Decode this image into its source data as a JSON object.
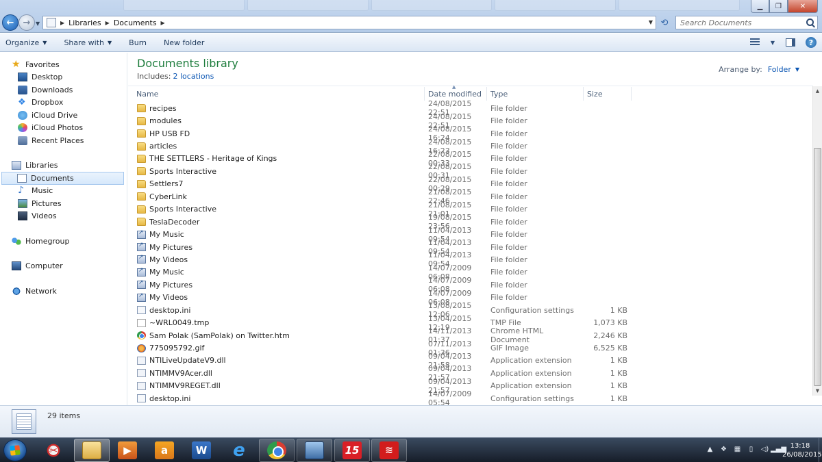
{
  "window": {
    "controls": [
      "minimize",
      "maximize",
      "close"
    ]
  },
  "address": {
    "crumbs": [
      "Libraries",
      "Documents"
    ]
  },
  "search": {
    "placeholder": "Search Documents"
  },
  "toolbar": {
    "organize": "Organize",
    "share_with": "Share with",
    "burn": "Burn",
    "new_folder": "New folder"
  },
  "navpane": {
    "favorites": {
      "label": "Favorites",
      "items": [
        {
          "label": "Desktop",
          "icon": "desktop-icon"
        },
        {
          "label": "Downloads",
          "icon": "downloads-icon"
        },
        {
          "label": "Dropbox",
          "icon": "dropbox-icon"
        },
        {
          "label": "iCloud Drive",
          "icon": "icloud-icon"
        },
        {
          "label": "iCloud Photos",
          "icon": "icloud-photos-icon"
        },
        {
          "label": "Recent Places",
          "icon": "recent-places-icon"
        }
      ]
    },
    "libraries": {
      "label": "Libraries",
      "items": [
        {
          "label": "Documents",
          "icon": "documents-icon",
          "selected": true
        },
        {
          "label": "Music",
          "icon": "music-icon"
        },
        {
          "label": "Pictures",
          "icon": "pictures-icon"
        },
        {
          "label": "Videos",
          "icon": "videos-icon"
        }
      ]
    },
    "homegroup": "Homegroup",
    "computer": "Computer",
    "network": "Network"
  },
  "library": {
    "title": "Documents library",
    "includes_label": "Includes:",
    "includes_link": "2 locations",
    "arrange_label": "Arrange by:",
    "arrange_value": "Folder"
  },
  "columns": {
    "name": "Name",
    "date": "Date modified",
    "type": "Type",
    "size": "Size"
  },
  "files": [
    {
      "name": "recipes",
      "date": "24/08/2015 22:51",
      "type": "File folder",
      "size": "",
      "icon": "folder"
    },
    {
      "name": "modules",
      "date": "24/08/2015 22:51",
      "type": "File folder",
      "size": "",
      "icon": "folder"
    },
    {
      "name": "HP USB FD",
      "date": "24/08/2015 16:24",
      "type": "File folder",
      "size": "",
      "icon": "folder"
    },
    {
      "name": "articles",
      "date": "24/08/2015 16:23",
      "type": "File folder",
      "size": "",
      "icon": "folder"
    },
    {
      "name": "THE SETTLERS - Heritage of Kings",
      "date": "22/08/2015 00:33",
      "type": "File folder",
      "size": "",
      "icon": "folder"
    },
    {
      "name": "Sports Interactive",
      "date": "22/08/2015 00:31",
      "type": "File folder",
      "size": "",
      "icon": "folder"
    },
    {
      "name": "Settlers7",
      "date": "22/08/2015 00:29",
      "type": "File folder",
      "size": "",
      "icon": "folder"
    },
    {
      "name": "CyberLink",
      "date": "21/08/2015 22:46",
      "type": "File folder",
      "size": "",
      "icon": "folder"
    },
    {
      "name": "Sports Interactive",
      "date": "21/08/2015 21:01",
      "type": "File folder",
      "size": "",
      "icon": "folder"
    },
    {
      "name": "TeslaDecoder",
      "date": "19/08/2015 23:56",
      "type": "File folder",
      "size": "",
      "icon": "folder"
    },
    {
      "name": "My Music",
      "date": "11/04/2013 09:54",
      "type": "File folder",
      "size": "",
      "icon": "shortcut"
    },
    {
      "name": "My Pictures",
      "date": "11/04/2013 09:54",
      "type": "File folder",
      "size": "",
      "icon": "shortcut"
    },
    {
      "name": "My Videos",
      "date": "11/04/2013 09:54",
      "type": "File folder",
      "size": "",
      "icon": "shortcut"
    },
    {
      "name": "My Music",
      "date": "14/07/2009 06:08",
      "type": "File folder",
      "size": "",
      "icon": "shortcut"
    },
    {
      "name": "My Pictures",
      "date": "14/07/2009 06:08",
      "type": "File folder",
      "size": "",
      "icon": "shortcut"
    },
    {
      "name": "My Videos",
      "date": "14/07/2009 06:08",
      "type": "File folder",
      "size": "",
      "icon": "shortcut"
    },
    {
      "name": "desktop.ini",
      "date": "13/08/2015 12:06",
      "type": "Configuration settings",
      "size": "1 KB",
      "icon": "ini"
    },
    {
      "name": "~WRL0049.tmp",
      "date": "13/04/2015 12:19",
      "type": "TMP File",
      "size": "1,073 KB",
      "icon": "tmp"
    },
    {
      "name": "Sam Polak (SamPolak) on Twitter.htm",
      "date": "14/11/2013 01:37",
      "type": "Chrome HTML Document",
      "size": "2,246 KB",
      "icon": "chrome"
    },
    {
      "name": "775095792.gif",
      "date": "07/11/2013 01:36",
      "type": "GIF Image",
      "size": "6,525 KB",
      "icon": "gif"
    },
    {
      "name": "NTILiveUpdateV9.dll",
      "date": "09/04/2013 21:58",
      "type": "Application extension",
      "size": "1 KB",
      "icon": "dll"
    },
    {
      "name": "NTIMMV9Acer.dll",
      "date": "09/04/2013 21:57",
      "type": "Application extension",
      "size": "1 KB",
      "icon": "dll"
    },
    {
      "name": "NTIMMV9REGET.dll",
      "date": "09/04/2013 21:57",
      "type": "Application extension",
      "size": "1 KB",
      "icon": "dll"
    },
    {
      "name": "desktop.ini",
      "date": "14/07/2009 05:54",
      "type": "Configuration settings",
      "size": "1 KB",
      "icon": "ini"
    }
  ],
  "details": {
    "item_count": "29 items"
  },
  "taskbar": {
    "apps": [
      "snipping-tool-icon",
      "windows-explorer-icon",
      "media-player-icon",
      "amazon-icon",
      "word-icon",
      "internet-explorer-icon",
      "chrome-icon",
      "calculator-icon",
      "fifteen-app-icon",
      "rss-app-icon"
    ],
    "clock_time": "13:18",
    "clock_date": "26/08/2015"
  }
}
